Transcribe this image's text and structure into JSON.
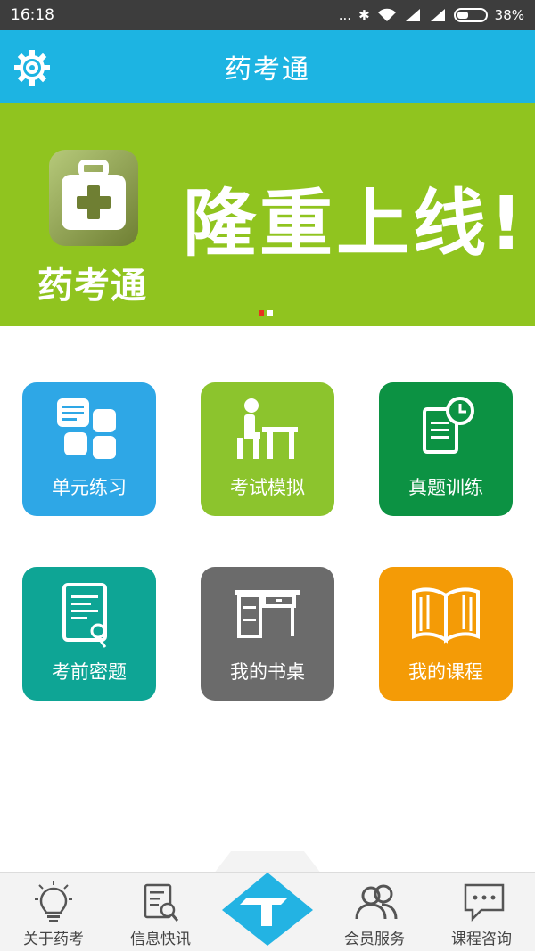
{
  "status_bar": {
    "time": "16:18",
    "signal_dots": "...",
    "battery_percent": "38%"
  },
  "header": {
    "title": "药考通",
    "settings_icon": "gear-icon",
    "color": "#1db4e2"
  },
  "banner": {
    "logo_text": "药考通",
    "slogan": "隆重上线!",
    "color": "#90c41f",
    "active_slide": 1,
    "slide_count": 2
  },
  "tiles": [
    {
      "label": "单元练习",
      "color": "#2ea7e6",
      "icon": "unit-practice-icon"
    },
    {
      "label": "考试模拟",
      "color": "#8cc42d",
      "icon": "exam-simulation-icon"
    },
    {
      "label": "真题训练",
      "color": "#0c9243",
      "icon": "past-papers-icon"
    },
    {
      "label": "考前密题",
      "color": "#0ea595",
      "icon": "secret-questions-icon"
    },
    {
      "label": "我的书桌",
      "color": "#6b6b6b",
      "icon": "desk-icon"
    },
    {
      "label": "我的课程",
      "color": "#f49b06",
      "icon": "book-icon"
    }
  ],
  "tabbar": {
    "items": [
      {
        "label": "关于药考",
        "icon": "lightbulb-icon"
      },
      {
        "label": "信息快讯",
        "icon": "news-search-icon"
      },
      {
        "label": "会员服务",
        "icon": "members-icon"
      },
      {
        "label": "课程咨询",
        "icon": "chat-icon"
      }
    ],
    "center_icon": "diamond-logo-icon",
    "center_color": "#23b3e3"
  }
}
